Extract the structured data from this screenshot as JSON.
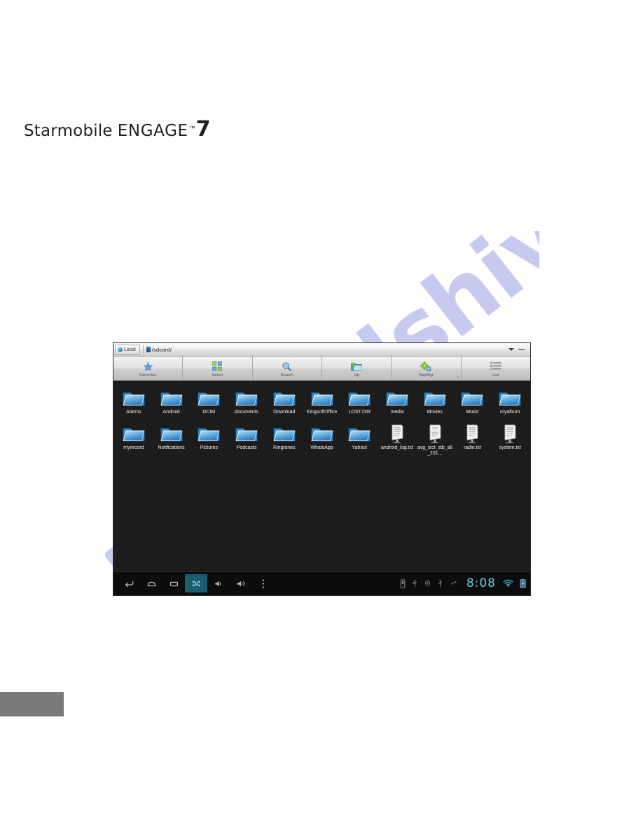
{
  "brand": {
    "word1": "Starmobile",
    "word2": "ENGAGE",
    "tm": "™",
    "model": "7"
  },
  "watermark": {
    "text": "manualshive.com",
    "color": "#c7caee"
  },
  "footer": {
    "color": "#7a7a7c"
  },
  "device": {
    "pathbar": {
      "tab_label": "Local",
      "tab_icon": "globe-icon",
      "device_icon": "sdcard-icon",
      "path": "/sdcard/",
      "dropdown_icon": "chevron-down-icon",
      "minimize_icon": "minimize-icon"
    },
    "toolbar": [
      {
        "label": "Favorites",
        "icon": "star-icon"
      },
      {
        "label": "Select",
        "icon": "grid-select-icon"
      },
      {
        "label": "Search",
        "icon": "magnifier-icon"
      },
      {
        "label": "Up",
        "icon": "folder-up-icon"
      },
      {
        "label": "AppMgr",
        "icon": "gear-apps-icon"
      },
      {
        "label": "List",
        "icon": "list-view-icon"
      }
    ],
    "files": {
      "row1": [
        {
          "name": "Alarms",
          "type": "folder"
        },
        {
          "name": "Android",
          "type": "folder"
        },
        {
          "name": "DCIM",
          "type": "folder"
        },
        {
          "name": "documents",
          "type": "folder"
        },
        {
          "name": "Download",
          "type": "folder"
        },
        {
          "name": "KingsoftOffice",
          "type": "folder"
        },
        {
          "name": "LOST.DIR",
          "type": "folder"
        },
        {
          "name": "media",
          "type": "folder"
        },
        {
          "name": "Movies",
          "type": "folder"
        },
        {
          "name": "Music",
          "type": "folder"
        },
        {
          "name": "myalbum",
          "type": "folder"
        }
      ],
      "row2": [
        {
          "name": "myrecord",
          "type": "folder"
        },
        {
          "name": "Notifications",
          "type": "folder"
        },
        {
          "name": "Pictures",
          "type": "folder"
        },
        {
          "name": "Podcasts",
          "type": "folder"
        },
        {
          "name": "Ringtones",
          "type": "folder"
        },
        {
          "name": "WhatsApp",
          "type": "folder"
        },
        {
          "name": "Yahoo!",
          "type": "folder"
        },
        {
          "name": "android_log.txt",
          "type": "textfile"
        },
        {
          "name": "avg_isct_stb_all_201...",
          "type": "textfile"
        },
        {
          "name": "radio.txt",
          "type": "textfile"
        },
        {
          "name": "system.txt",
          "type": "textfile"
        }
      ]
    },
    "navbar": {
      "buttons": [
        {
          "icon": "back-icon",
          "active": false
        },
        {
          "icon": "home-icon",
          "active": false
        },
        {
          "icon": "recents-icon",
          "active": false
        },
        {
          "icon": "screenshot-icon",
          "active": true
        },
        {
          "icon": "volume-down-icon",
          "active": false
        },
        {
          "icon": "volume-up-icon",
          "active": false
        },
        {
          "icon": "overflow-menu-icon",
          "active": false
        }
      ],
      "status_icons": [
        "sdcard-status-icon",
        "usb-icon",
        "usb-debug-icon",
        "usb-connected-icon",
        "notification-icon"
      ],
      "clock": "8:08",
      "wifi_icon": "wifi-icon",
      "battery_icon": "battery-charging-icon",
      "clock_color": "#5fd3e8"
    }
  }
}
